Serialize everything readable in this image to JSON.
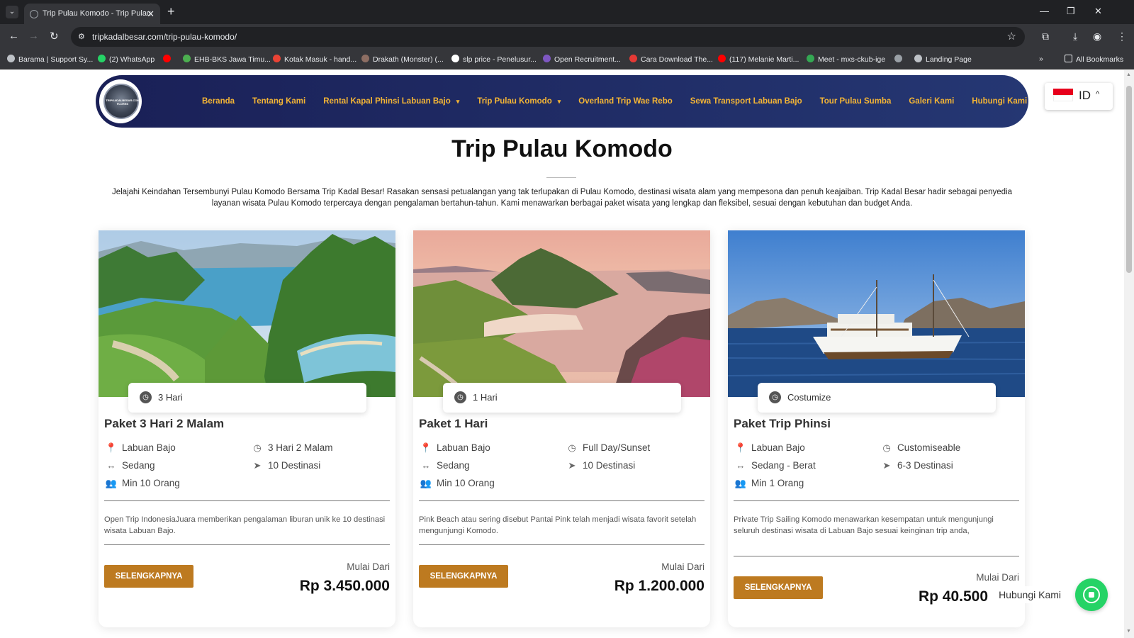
{
  "browser": {
    "tab_title": "Trip Pulau Komodo - Trip Pulau",
    "url": "tripkadalbesar.com/trip-pulau-komodo/",
    "bookmarks": [
      {
        "label": "Barama | Support Sy...",
        "color": "#bdc1c6"
      },
      {
        "label": "(2) WhatsApp",
        "color": "#25d366"
      },
      {
        "label": "",
        "color": "#ff0000"
      },
      {
        "label": "EHB-BKS Jawa Timu...",
        "color": "#4caf50"
      },
      {
        "label": "Kotak Masuk - hand...",
        "color": "#ea4335"
      },
      {
        "label": "Drakath (Monster) (...",
        "color": "#8d6e63"
      },
      {
        "label": "slp price - Penelusur...",
        "color": "#ffffff"
      },
      {
        "label": "Open Recruitment...",
        "color": "#7e57c2"
      },
      {
        "label": "Cara Download The...",
        "color": "#e53935"
      },
      {
        "label": "(117) Melanie Marti...",
        "color": "#ff0000"
      },
      {
        "label": "Meet - mxs-ckub-ige",
        "color": "#34a853"
      },
      {
        "label": "",
        "color": "#9aa0a6"
      },
      {
        "label": "Landing Page",
        "color": "#bdc1c6"
      }
    ],
    "all_bookmarks": "All Bookmarks"
  },
  "site": {
    "logo_text": "TRIPKADALBESAR.COM FLORES",
    "menu": [
      {
        "label": "Beranda",
        "dropdown": false
      },
      {
        "label": "Tentang Kami",
        "dropdown": false
      },
      {
        "label": "Rental Kapal Phinsi Labuan Bajo",
        "dropdown": true
      },
      {
        "label": "Trip Pulau Komodo",
        "dropdown": true
      },
      {
        "label": "Overland Trip Wae Rebo",
        "dropdown": false
      },
      {
        "label": "Sewa Transport Labuan Bajo",
        "dropdown": false
      },
      {
        "label": "Tour Pulau Sumba",
        "dropdown": false
      },
      {
        "label": "Galeri Kami",
        "dropdown": false
      },
      {
        "label": "Hubungi Kami",
        "dropdown": false
      }
    ],
    "lang": {
      "code": "ID"
    }
  },
  "main": {
    "title": "Trip Pulau Komodo",
    "intro": "Jelajahi Keindahan Tersembunyi Pulau Komodo Bersama Trip Kadal Besar! Rasakan sensasi petualangan yang tak terlupakan di Pulau Komodo, destinasi wisata alam yang mempesona dan penuh keajaiban. Trip Kadal Besar hadir sebagai penyedia layanan wisata Pulau Komodo terpercaya dengan pengalaman bertahun-tahun. Kami menawarkan berbagai paket wisata yang lengkap dan fleksibel, sesuai dengan kebutuhan dan budget Anda."
  },
  "cards": [
    {
      "duration": "3 Hari",
      "title": "Paket 3 Hari 2 Malam",
      "location": "Labuan Bajo",
      "time": "3 Hari 2 Malam",
      "level": "Sedang",
      "destinations": "10 Destinasi",
      "min": "Min 10 Orang",
      "description": "Open Trip IndonesiaJuara memberikan pengalaman liburan unik ke 10 destinasi wisata Labuan Bajo.",
      "button": "SELENGKAPNYA",
      "from_label": "Mulai Dari",
      "price": "Rp 3.450.000"
    },
    {
      "duration": "1 Hari",
      "title": "Paket 1 Hari",
      "location": "Labuan Bajo",
      "time": "Full Day/Sunset",
      "level": "Sedang",
      "destinations": "10 Destinasi",
      "min": "Min 10 Orang",
      "description": "Pink Beach atau sering disebut Pantai Pink telah menjadi wisata favorit setelah mengunjungi Komodo.",
      "button": "SELENGKAPNYA",
      "from_label": "Mulai Dari",
      "price": "Rp 1.200.000"
    },
    {
      "duration": "Costumize",
      "title": "Paket Trip Phinsi",
      "location": "Labuan Bajo",
      "time": "Customiseable",
      "level": "Sedang - Berat",
      "destinations": "6-3 Destinasi",
      "min": "Min 1 Orang",
      "description": "Private Trip Sailing Komodo menawarkan kesempatan untuk mengunjungi seluruh destinasi wisata di Labuan Bajo sesuai keinginan trip anda,",
      "button": "SELENGKAPNYA",
      "from_label": "Mulai Dari",
      "price": "Rp 40.500"
    }
  ],
  "whatsapp": {
    "label": "Hubungi Kami"
  },
  "colors": {
    "navbar": "#1a2057",
    "menu_text": "#f4b535",
    "button": "#bd7a20",
    "whatsapp": "#25d366"
  },
  "icons": {
    "clock": "clock-icon",
    "pin": "map-pin-icon",
    "level": "arrows-h-icon",
    "nav": "location-arrow-icon",
    "people": "users-icon"
  }
}
